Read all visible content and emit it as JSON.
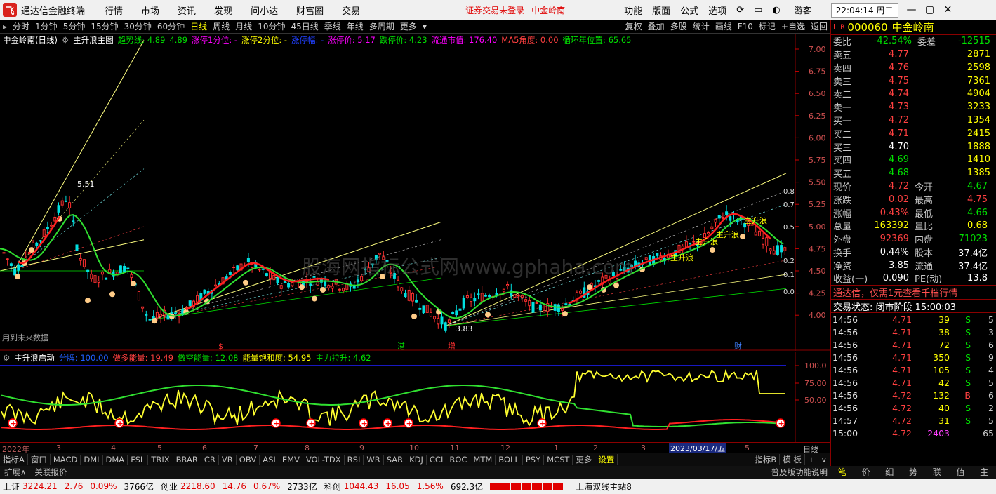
{
  "titlebar": {
    "app_name": "通达信金融终端",
    "menu": [
      "行情",
      "市场",
      "资讯",
      "发现",
      "问小达",
      "财富圈",
      "交易"
    ],
    "notice": "证券交易未登录",
    "stock_name": "中金岭南",
    "right_menu": [
      "功能",
      "版面",
      "公式",
      "选项"
    ],
    "user": "游客",
    "clock": "22:04:14 周二"
  },
  "periodbar": {
    "periods": [
      "分时",
      "1分钟",
      "5分钟",
      "15分钟",
      "30分钟",
      "60分钟",
      "日线",
      "周线",
      "月线",
      "10分钟",
      "45日线",
      "季线",
      "年线",
      "多周期",
      "更多"
    ],
    "active": "日线",
    "tools": [
      "复权",
      "叠加",
      "多股",
      "统计",
      "画线",
      "F10",
      "标记",
      "+自选",
      "返回"
    ]
  },
  "main_indicator": {
    "title": "中金岭南(日线)",
    "formula": "主升浪主图",
    "trend_line": "趋势线: 4.89",
    "trend_val": "4.89",
    "lu1": "涨停1分位: -",
    "lu2": "涨停2分位: -",
    "luamp": "涨停幅: -",
    "limit_up": "涨停价: 5.17",
    "limit_down": "跌停价: 4.23",
    "float_cap": "流通市值: 176.40",
    "ma5_angle": "MA5角度: 0.00",
    "cycle_pos": "循环年位置: 65.65",
    "future_data": "用到未来数据",
    "watermark": "股海网指标公式网www.gphaha.com",
    "high_label": "5.51",
    "low_label": "3.83",
    "markers": [
      "$",
      "港",
      "增",
      "财"
    ],
    "wave_labels": [
      "主升浪",
      "主升浪",
      "主升浪",
      "主升浪"
    ]
  },
  "price_axis": [
    "7.00",
    "6.75",
    "6.50",
    "6.25",
    "6.00",
    "5.75",
    "5.50",
    "5.25",
    "5.00",
    "4.75",
    "4.50",
    "4.25",
    "4.00"
  ],
  "fib_levels": [
    "0.8",
    "0.7",
    "0.5",
    "0.2",
    "0.1",
    "0.0"
  ],
  "lower_indicator": {
    "name": "主升浪启动",
    "fenpai": "分牌: 100.00",
    "duo": "做多能量: 19.49",
    "kong": "做空能量: 12.08",
    "baohe": "能量饱和度: 54.95",
    "lasheng": "主力拉升: 4.62",
    "axis": [
      "100.0",
      "75.00",
      "50.00"
    ]
  },
  "xaxis": {
    "labels": [
      "2022年",
      "3",
      "4",
      "5",
      "6",
      "7",
      "8",
      "9",
      "10",
      "11",
      "12",
      "1",
      "2",
      "3",
      "2023/03/17/五",
      "5"
    ],
    "period": "日线"
  },
  "tabs": {
    "left": "指标A",
    "items": [
      "窗口",
      "MACD",
      "DMI",
      "DMA",
      "FSL",
      "TRIX",
      "BRAR",
      "CR",
      "VR",
      "OBV",
      "ASI",
      "EMV",
      "VOL-TDX",
      "RSI",
      "WR",
      "SAR",
      "KDJ",
      "CCI",
      "ROC",
      "MTM",
      "BOLL",
      "PSY",
      "MCST",
      "更多",
      "设置"
    ],
    "selected": "设置",
    "right": [
      "指标B",
      "模 板",
      "+",
      "∨"
    ]
  },
  "bottombar": {
    "expand": "扩展∧",
    "related": "关联报价",
    "help": "普及版功能说明"
  },
  "status": {
    "sh_name": "上证",
    "sh_val": "3224.21",
    "sh_chg": "2.76",
    "sh_pct": "0.09%",
    "sh_amt": "3766亿",
    "cy_name": "创业",
    "cy_val": "2218.60",
    "cy_chg": "14.76",
    "cy_pct": "0.67%",
    "cy_amt": "2733亿",
    "kc_name": "科创",
    "kc_val": "1044.43",
    "kc_chg": "16.05",
    "kc_pct": "1.56%",
    "kc_amt": "692.3亿",
    "server": "上海双线主站8"
  },
  "quote": {
    "code": "000060",
    "name": "中金岭南",
    "wb_label": "委比",
    "wb": "-42.54%",
    "wc_label": "委差",
    "wc": "-12515",
    "asks": [
      {
        "label": "卖五",
        "price": "4.77",
        "vol": "2871"
      },
      {
        "label": "卖四",
        "price": "4.76",
        "vol": "2598"
      },
      {
        "label": "卖三",
        "price": "4.75",
        "vol": "7361"
      },
      {
        "label": "卖二",
        "price": "4.74",
        "vol": "4904"
      },
      {
        "label": "卖一",
        "price": "4.73",
        "vol": "3233"
      }
    ],
    "bids": [
      {
        "label": "买一",
        "price": "4.72",
        "vol": "1354"
      },
      {
        "label": "买二",
        "price": "4.71",
        "vol": "2415"
      },
      {
        "label": "买三",
        "price": "4.70",
        "vol": "1888"
      },
      {
        "label": "买四",
        "price": "4.69",
        "vol": "1410"
      },
      {
        "label": "买五",
        "price": "4.68",
        "vol": "1385"
      }
    ],
    "stats": [
      [
        "现价",
        "4.72",
        "今开",
        "4.67"
      ],
      [
        "涨跌",
        "0.02",
        "最高",
        "4.75"
      ],
      [
        "涨幅",
        "0.43%",
        "最低",
        "4.66"
      ],
      [
        "总量",
        "163392",
        "量比",
        "0.68"
      ],
      [
        "外盘",
        "92369",
        "内盘",
        "71023"
      ]
    ],
    "stats2": [
      [
        "换手",
        "0.44%",
        "股本",
        "37.4亿"
      ],
      [
        "净资",
        "3.85",
        "流通",
        "37.4亿"
      ],
      [
        "收益(一)",
        "0.090",
        "PE(动)",
        "13.8"
      ]
    ],
    "promo": "通达信，仅需1元查看千档行情",
    "trade_status": "交易状态: 闭市阶段 15:00:03",
    "ticks": [
      [
        "14:56",
        "4.71",
        "39",
        "S",
        "5"
      ],
      [
        "14:56",
        "4.71",
        "38",
        "S",
        "3"
      ],
      [
        "14:56",
        "4.71",
        "72",
        "S",
        "6"
      ],
      [
        "14:56",
        "4.71",
        "350",
        "S",
        "9"
      ],
      [
        "14:56",
        "4.71",
        "105",
        "S",
        "4"
      ],
      [
        "14:56",
        "4.71",
        "42",
        "S",
        "5"
      ],
      [
        "14:56",
        "4.72",
        "132",
        "B",
        "6"
      ],
      [
        "14:56",
        "4.72",
        "40",
        "S",
        "2"
      ],
      [
        "14:57",
        "4.72",
        "31",
        "S",
        "5"
      ],
      [
        "15:00",
        "4.72",
        "2403",
        "",
        "65"
      ]
    ],
    "bottom_tabs": [
      "笔",
      "价",
      "细",
      "势",
      "联",
      "值",
      "主"
    ]
  }
}
